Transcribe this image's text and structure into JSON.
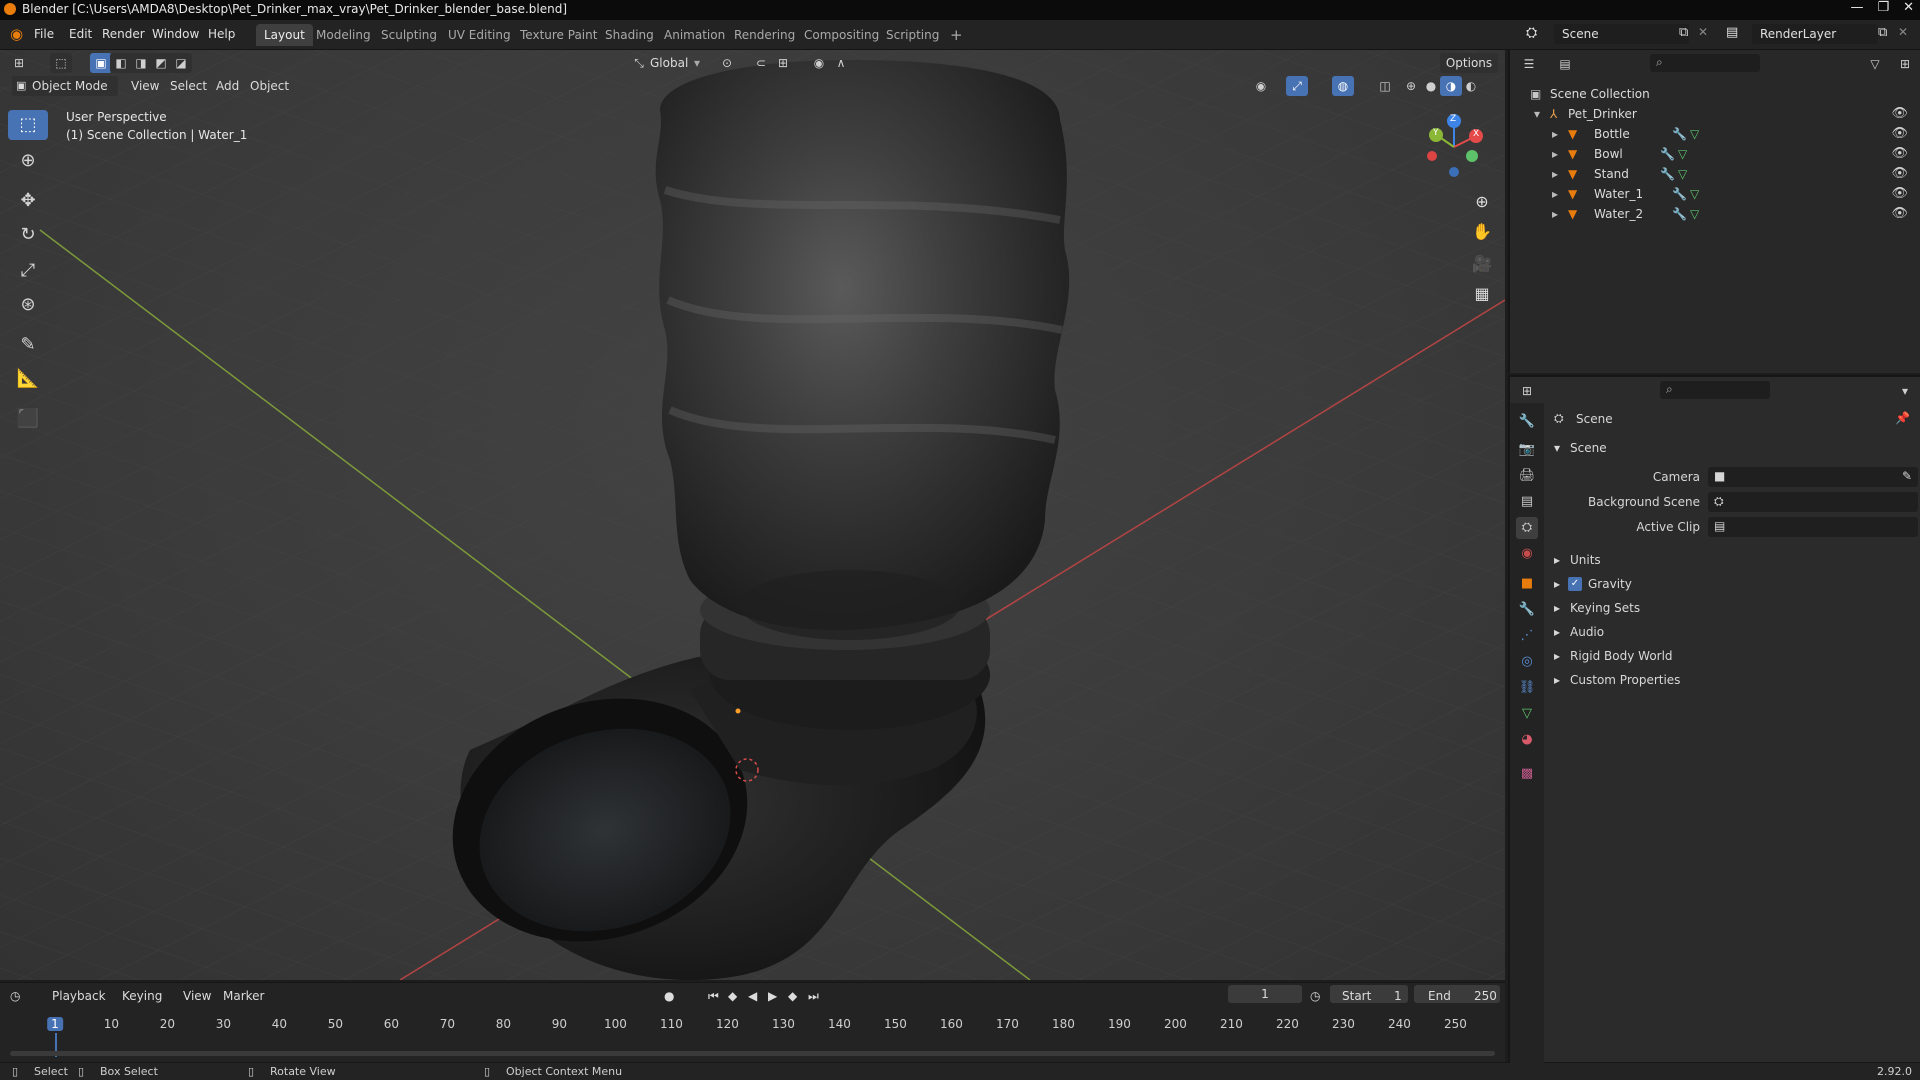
{
  "window": {
    "title": "Blender [C:\\Users\\AMDA8\\Desktop\\Pet_Drinker_max_vray\\Pet_Drinker_blender_base.blend]",
    "controls": [
      "—",
      "❐",
      "✕"
    ]
  },
  "menu": [
    "File",
    "Edit",
    "Render",
    "Window",
    "Help"
  ],
  "workspaces": [
    "Layout",
    "Modeling",
    "Sculpting",
    "UV Editing",
    "Texture Paint",
    "Shading",
    "Animation",
    "Rendering",
    "Compositing",
    "Scripting"
  ],
  "active_workspace": "Layout",
  "add_workspace": "+",
  "scene_name": "Scene",
  "view_layer": "RenderLayer",
  "viewport": {
    "mode": "Object Mode",
    "menus": [
      "View",
      "Select",
      "Add",
      "Object"
    ],
    "transform_orientation": "Global",
    "options": "Options",
    "overlay_line1": "User Perspective",
    "overlay_line2": "(1) Scene Collection | Water_1",
    "gizmo": {
      "x": "X",
      "y": "Y",
      "z": "Z"
    }
  },
  "outliner": {
    "root": "Scene Collection",
    "collection": "Pet_Drinker",
    "objects": [
      "Bottle",
      "Bowl",
      "Stand",
      "Water_1",
      "Water_2"
    ]
  },
  "properties": {
    "header": "Scene",
    "panel": "Scene",
    "fields": [
      {
        "label": "Camera"
      },
      {
        "label": "Background Scene"
      },
      {
        "label": "Active Clip"
      }
    ],
    "subpanels": [
      "Units",
      "Gravity",
      "Keying Sets",
      "Audio",
      "Rigid Body World",
      "Custom Properties"
    ]
  },
  "timeline": {
    "menus": [
      "Playback",
      "Keying",
      "View",
      "Marker"
    ],
    "current_frame": "1",
    "start_label": "Start",
    "start": "1",
    "end_label": "End",
    "end": "250",
    "ticks": [
      "1",
      "10",
      "20",
      "30",
      "40",
      "50",
      "60",
      "70",
      "80",
      "90",
      "100",
      "110",
      "120",
      "130",
      "140",
      "150",
      "160",
      "170",
      "180",
      "190",
      "200",
      "210",
      "220",
      "230",
      "240",
      "250"
    ]
  },
  "status": {
    "select": "Select",
    "box_select": "Box Select",
    "rotate": "Rotate View",
    "context": "Object Context Menu",
    "version": "2.92.0"
  },
  "colors": {
    "accent": "#4772b3",
    "object_orange": "#e87d0d",
    "mesh_green": "#5ec26a",
    "x_axis": "#e44a4a",
    "y_axis": "#8ab736",
    "z_axis": "#3d84e6"
  }
}
